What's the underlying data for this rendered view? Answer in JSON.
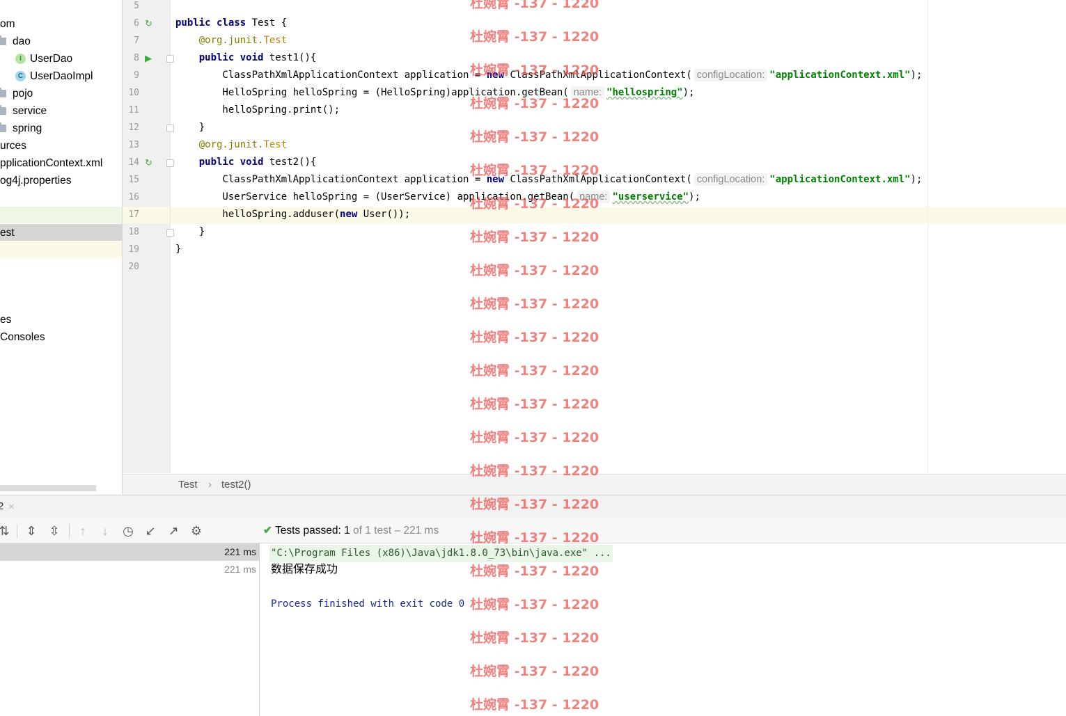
{
  "project_tree": {
    "items": [
      {
        "label": "om",
        "icon": "none",
        "indent": 0
      },
      {
        "label": "dao",
        "icon": "folder-icon",
        "indent": 1
      },
      {
        "label": "UserDao",
        "icon": "interface-icon",
        "badge": "I",
        "indent": 2
      },
      {
        "label": "UserDaoImpl",
        "icon": "class-icon",
        "badge": "C",
        "indent": 2
      },
      {
        "label": "pojo",
        "icon": "folder-icon",
        "indent": 1
      },
      {
        "label": "service",
        "icon": "folder-icon",
        "indent": 1
      },
      {
        "label": "spring",
        "icon": "folder-icon",
        "indent": 1
      },
      {
        "label": "urces",
        "icon": "none",
        "indent": 0
      },
      {
        "label": "pplicationContext.xml",
        "icon": "none",
        "indent": 0
      },
      {
        "label": "og4j.properties",
        "icon": "none",
        "indent": 0
      },
      {
        "label": "",
        "icon": "none",
        "indent": 0
      },
      {
        "label": "",
        "icon": "none",
        "indent": 0
      },
      {
        "label": "est",
        "icon": "none",
        "indent": 0
      },
      {
        "label": "",
        "icon": "none",
        "indent": 0
      },
      {
        "label": "",
        "icon": "none",
        "indent": 0
      },
      {
        "label": "",
        "icon": "none",
        "indent": 0
      },
      {
        "label": "",
        "icon": "none",
        "indent": 0
      },
      {
        "label": "es",
        "icon": "none",
        "indent": 0
      },
      {
        "label": "Consoles",
        "icon": "none",
        "indent": 0
      }
    ]
  },
  "editor": {
    "lines": [
      {
        "n": "5",
        "run": "",
        "fold": false,
        "code": []
      },
      {
        "n": "6",
        "run": "↻",
        "fold": false,
        "code": [
          [
            "kw",
            "public class "
          ],
          [
            "t",
            "Test {"
          ]
        ]
      },
      {
        "n": "7",
        "run": "",
        "fold": false,
        "code": [
          [
            "t",
            "    "
          ],
          [
            "ann",
            "@org.junit."
          ],
          [
            "ann2",
            "Test"
          ]
        ]
      },
      {
        "n": "8",
        "run": "▶",
        "fold": true,
        "code": [
          [
            "t",
            "    "
          ],
          [
            "kw",
            "public void "
          ],
          [
            "t",
            "test1(){"
          ]
        ]
      },
      {
        "n": "9",
        "run": "",
        "fold": false,
        "code": [
          [
            "t",
            "        ClassPathXmlApplicationContext application = "
          ],
          [
            "kw",
            "new "
          ],
          [
            "t",
            "ClassPathXmlApplicationContext("
          ],
          [
            "hint",
            "configLocation:"
          ],
          [
            "str",
            "\"applicationContext.xml\""
          ],
          [
            "t",
            ");"
          ]
        ]
      },
      {
        "n": "10",
        "run": "",
        "fold": false,
        "code": [
          [
            "t",
            "        HelloSpring helloSpring = (HelloSpring)application.getBean("
          ],
          [
            "hint",
            "name:"
          ],
          [
            "strw",
            "\"hellospring\""
          ],
          [
            "t",
            ");"
          ]
        ]
      },
      {
        "n": "11",
        "run": "",
        "fold": false,
        "code": [
          [
            "t",
            "        helloSpring.print();"
          ]
        ]
      },
      {
        "n": "12",
        "run": "",
        "fold": true,
        "code": [
          [
            "t",
            "    }"
          ]
        ]
      },
      {
        "n": "13",
        "run": "",
        "fold": false,
        "code": [
          [
            "t",
            "    "
          ],
          [
            "ann",
            "@org.junit."
          ],
          [
            "ann2",
            "Test"
          ]
        ]
      },
      {
        "n": "14",
        "run": "↻",
        "fold": true,
        "code": [
          [
            "t",
            "    "
          ],
          [
            "kw",
            "public void "
          ],
          [
            "t",
            "test2(){"
          ]
        ]
      },
      {
        "n": "15",
        "run": "",
        "fold": false,
        "code": [
          [
            "t",
            "        ClassPathXmlApplicationContext application = "
          ],
          [
            "kw",
            "new "
          ],
          [
            "t",
            "ClassPathXmlApplicationContext("
          ],
          [
            "hint",
            "configLocation:"
          ],
          [
            "str",
            "\"applicationContext.xml\""
          ],
          [
            "t",
            ");"
          ]
        ]
      },
      {
        "n": "16",
        "run": "",
        "fold": false,
        "code": [
          [
            "t",
            "        UserService helloSpring = (UserService) application.getBean("
          ],
          [
            "hint",
            "name:"
          ],
          [
            "strw",
            "\"userservice\""
          ],
          [
            "t",
            ");"
          ]
        ]
      },
      {
        "n": "17",
        "run": "",
        "fold": false,
        "code": [
          [
            "t",
            "        helloSpring.adduser("
          ],
          [
            "kw",
            "new "
          ],
          [
            "t",
            "User());"
          ]
        ]
      },
      {
        "n": "18",
        "run": "",
        "fold": true,
        "code": [
          [
            "t",
            "    }"
          ]
        ]
      },
      {
        "n": "19",
        "run": "",
        "fold": false,
        "code": [
          [
            "t",
            "}"
          ]
        ]
      },
      {
        "n": "20",
        "run": "",
        "fold": false,
        "code": []
      }
    ]
  },
  "breadcrumbs": {
    "class_name": "Test",
    "separator": "›",
    "method_name": "test2()"
  },
  "run_window": {
    "tab_label": "2",
    "tab_close": "×",
    "toolbar_icons": [
      {
        "name": "sort-icon",
        "glyph": "⇅",
        "dim": false
      },
      {
        "name": "expand-all-icon",
        "glyph": "⇕",
        "dim": false
      },
      {
        "name": "collapse-all-icon",
        "glyph": "⇳",
        "dim": false
      },
      {
        "name": "prev-failed-icon",
        "glyph": "↑",
        "dim": true
      },
      {
        "name": "next-failed-icon",
        "glyph": "↓",
        "dim": true
      },
      {
        "name": "history-icon",
        "glyph": "◷",
        "dim": false
      },
      {
        "name": "import-tests-icon",
        "glyph": "↙",
        "dim": false
      },
      {
        "name": "export-tests-icon",
        "glyph": "↗",
        "dim": false
      },
      {
        "name": "settings-gear-icon",
        "glyph": "⚙",
        "dim": false
      }
    ],
    "status": {
      "prefix": "Tests passed: ",
      "count": "1",
      "rest": " of 1 test – 221 ms"
    },
    "test_rows": [
      {
        "time": "221 ms",
        "selected": true
      },
      {
        "time": "221 ms",
        "selected": false
      }
    ],
    "console": {
      "command": "\"C:\\Program Files (x86)\\Java\\jdk1.8.0_73\\bin\\java.exe\" ...",
      "output": "数据保存成功",
      "exit_message": "Process finished with exit code 0"
    }
  },
  "watermark": {
    "text": "杜婉霄 -137 - 1220",
    "color": "#ea5050"
  }
}
